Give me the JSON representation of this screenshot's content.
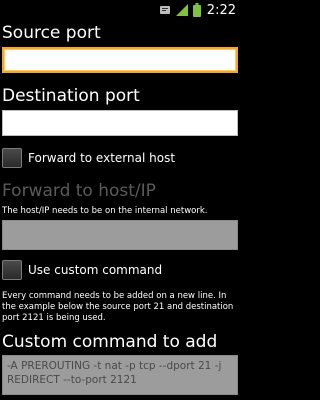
{
  "status_bar": {
    "time": "2:22",
    "icons": [
      "notification-icon",
      "signal-icon",
      "battery-icon"
    ]
  },
  "form": {
    "source_port": {
      "label": "Source port",
      "value": ""
    },
    "destination_port": {
      "label": "Destination port",
      "value": ""
    },
    "forward_external": {
      "label": "Forward to external host",
      "checked": false
    },
    "forward_host": {
      "label": "Forward to host/IP",
      "note": "The host/IP needs to be on the internal network.",
      "value": ""
    },
    "custom_command": {
      "label": "Use custom command",
      "checked": false,
      "note": "Every command needs to be added on a new line. In the example below the source port 21 and destination port 2121 is being used."
    },
    "custom_command_input": {
      "label": "Custom command to add",
      "placeholder": "-A PREROUTING -t nat -p tcp --dport 21 -j REDIRECT --to-port 2121"
    }
  },
  "colors": {
    "background": "#000000",
    "focus_accent": "#f4a62a",
    "disabled_field": "#9c9c9c",
    "disabled_text": "#5a5a5a"
  }
}
